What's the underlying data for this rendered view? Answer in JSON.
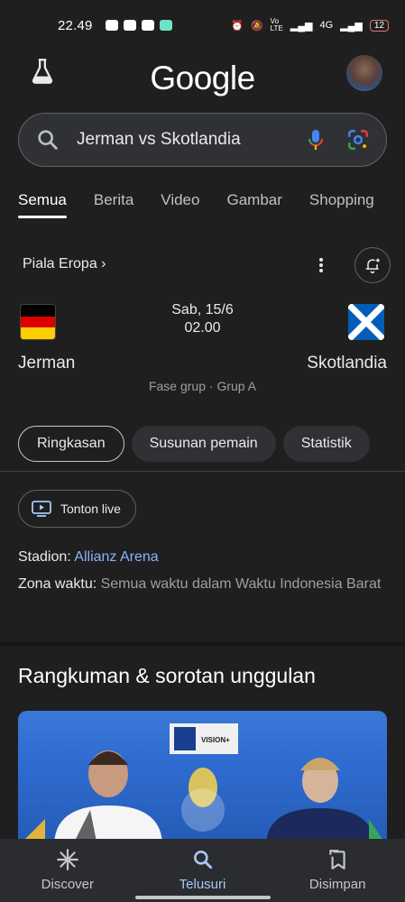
{
  "status_bar": {
    "time": "22.49",
    "network_label": "4G",
    "battery": "12"
  },
  "header": {
    "logo_text": "Google",
    "labs_icon": "flask-icon",
    "avatar": "user-avatar"
  },
  "search": {
    "query": "Jerman vs Skotlandia",
    "icons": [
      "search-icon",
      "mic-icon",
      "lens-icon"
    ]
  },
  "tabs": [
    "Semua",
    "Berita",
    "Video",
    "Gambar",
    "Shopping"
  ],
  "active_tab": "Semua",
  "competition": {
    "label": "Piala Eropa ›"
  },
  "match": {
    "home_team": "Jerman",
    "away_team": "Skotlandia",
    "date": "Sab, 15/6",
    "time": "02.00",
    "stage": "Fase grup · Grup A"
  },
  "chips": [
    "Ringkasan",
    "Susunan pemain",
    "Statistik"
  ],
  "active_chip": "Ringkasan",
  "watch_live": "Tonton live",
  "details": {
    "stadium_label": "Stadion:",
    "stadium_value": "Allianz Arena",
    "timezone_label": "Zona waktu:",
    "timezone_value": "Semua waktu dalam Waktu Indonesia Barat"
  },
  "highlights": {
    "title": "Rangkuman & sorotan unggulan",
    "banner_text": "VISION+"
  },
  "bottom_nav": [
    "Discover",
    "Telusuri",
    "Disimpan"
  ],
  "active_nav": "Telusuri",
  "colors": {
    "background": "#1f1f1f",
    "accent_blue": "#8ab4f8",
    "nav_active": "#a8c7fa"
  }
}
